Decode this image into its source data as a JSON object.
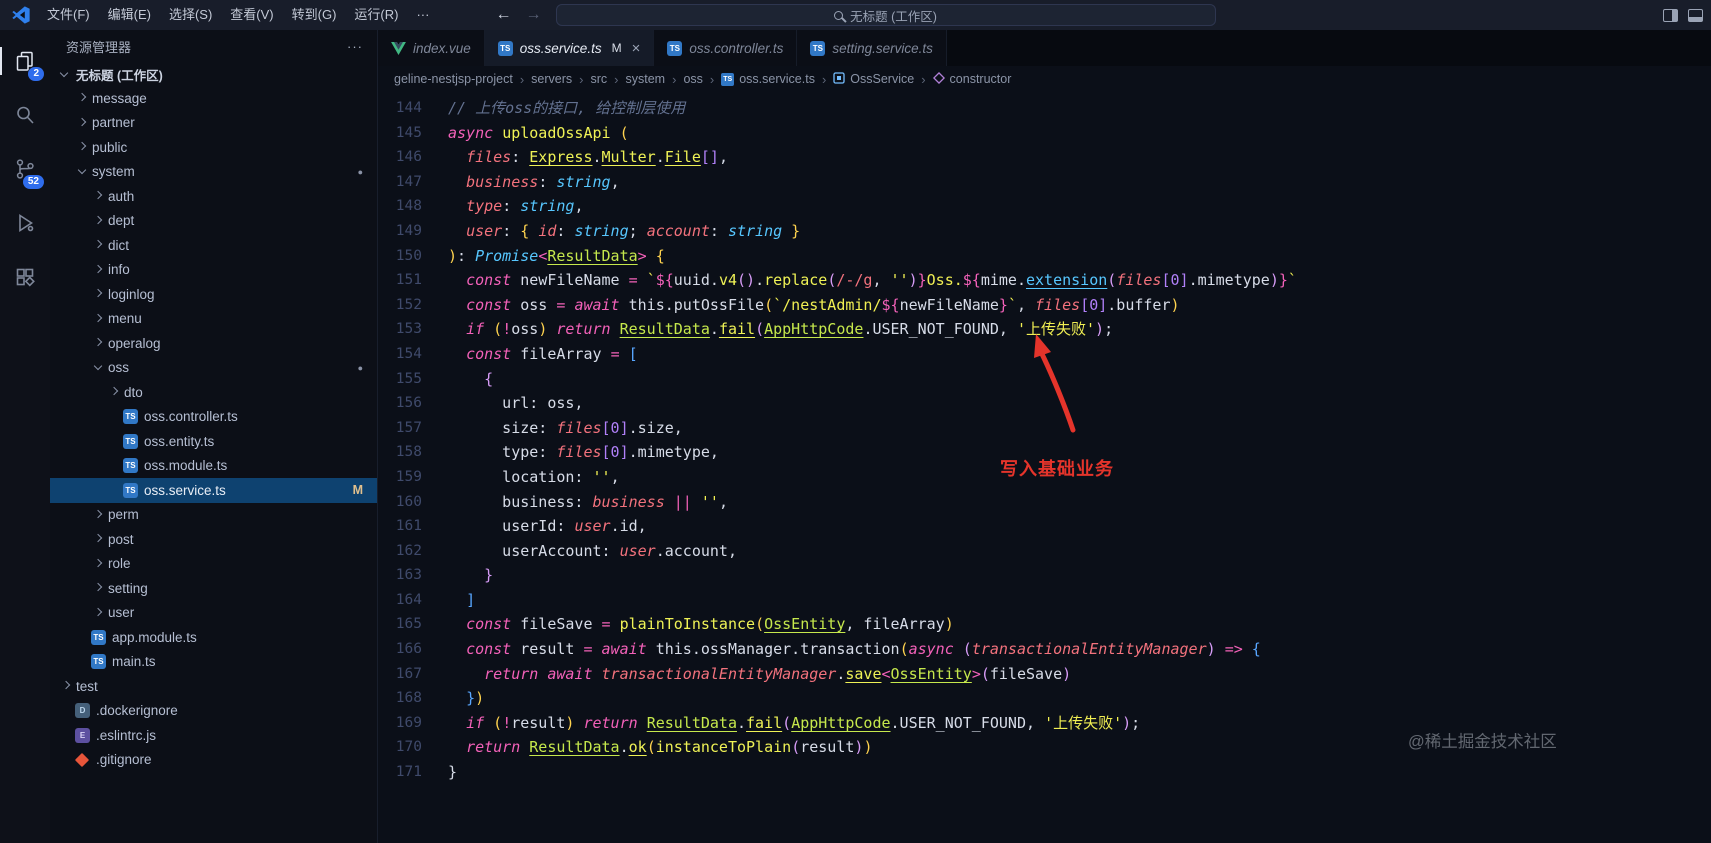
{
  "titlebar": {
    "menus": [
      "文件(F)",
      "编辑(E)",
      "选择(S)",
      "查看(V)",
      "转到(G)",
      "运行(R)"
    ],
    "more_label": "···",
    "search": "无标题 (工作区)"
  },
  "activitybar": {
    "explorer_badge": "2",
    "scm_badge": "52"
  },
  "sidebar": {
    "title": "资源管理器",
    "more_label": "···",
    "section": "无标题 (工作区)",
    "tree": [
      {
        "label": "message",
        "indent": 1,
        "chevron": "right"
      },
      {
        "label": "partner",
        "indent": 1,
        "chevron": "right"
      },
      {
        "label": "public",
        "indent": 1,
        "chevron": "right"
      },
      {
        "label": "system",
        "indent": 1,
        "chevron": "down",
        "dot": true
      },
      {
        "label": "auth",
        "indent": 2,
        "chevron": "right"
      },
      {
        "label": "dept",
        "indent": 2,
        "chevron": "right"
      },
      {
        "label": "dict",
        "indent": 2,
        "chevron": "right"
      },
      {
        "label": "info",
        "indent": 2,
        "chevron": "right"
      },
      {
        "label": "loginlog",
        "indent": 2,
        "chevron": "right"
      },
      {
        "label": "menu",
        "indent": 2,
        "chevron": "right"
      },
      {
        "label": "operalog",
        "indent": 2,
        "chevron": "right"
      },
      {
        "label": "oss",
        "indent": 2,
        "chevron": "down",
        "dot": true
      },
      {
        "label": "dto",
        "indent": 3,
        "chevron": "right"
      },
      {
        "label": "oss.controller.ts",
        "indent": 3,
        "icon": "ts"
      },
      {
        "label": "oss.entity.ts",
        "indent": 3,
        "icon": "ts"
      },
      {
        "label": "oss.module.ts",
        "indent": 3,
        "icon": "ts"
      },
      {
        "label": "oss.service.ts",
        "indent": 3,
        "icon": "ts",
        "selected": true,
        "badge": "M"
      },
      {
        "label": "perm",
        "indent": 2,
        "chevron": "right"
      },
      {
        "label": "post",
        "indent": 2,
        "chevron": "right"
      },
      {
        "label": "role",
        "indent": 2,
        "chevron": "right"
      },
      {
        "label": "setting",
        "indent": 2,
        "chevron": "right"
      },
      {
        "label": "user",
        "indent": 2,
        "chevron": "right"
      },
      {
        "label": "app.module.ts",
        "indent": 1,
        "icon": "ts"
      },
      {
        "label": "main.ts",
        "indent": 1,
        "icon": "ts"
      },
      {
        "label": "test",
        "indent": 0,
        "chevron": "right"
      },
      {
        "label": ".dockerignore",
        "indent": 0,
        "icon": "docker"
      },
      {
        "label": ".eslintrc.js",
        "indent": 0,
        "icon": "eslint"
      },
      {
        "label": ".gitignore",
        "indent": 0,
        "icon": "git"
      }
    ]
  },
  "tabs": [
    {
      "label": "index.vue",
      "icon": "vue"
    },
    {
      "label": "oss.service.ts",
      "icon": "ts",
      "active": true,
      "modified": "M",
      "closable": true
    },
    {
      "label": "oss.controller.ts",
      "icon": "ts"
    },
    {
      "label": "setting.service.ts",
      "icon": "ts"
    }
  ],
  "breadcrumb": [
    {
      "label": "geline-nestjsp-project"
    },
    {
      "label": "servers"
    },
    {
      "label": "src"
    },
    {
      "label": "system"
    },
    {
      "label": "oss"
    },
    {
      "label": "oss.service.ts",
      "icon": "ts"
    },
    {
      "label": "OssService",
      "icon": "class"
    },
    {
      "label": "constructor",
      "icon": "method"
    }
  ],
  "editor": {
    "lines": [
      {
        "n": 144,
        "t": [
          [
            "cm",
            "// 上传oss的接口, 给控制层使用"
          ]
        ]
      },
      {
        "n": 145,
        "t": [
          [
            "kw",
            "async"
          ],
          [
            "pl",
            " "
          ],
          [
            "fn",
            "uploadOssApi"
          ],
          [
            "pl",
            " "
          ],
          [
            "b1",
            "("
          ]
        ]
      },
      {
        "n": 146,
        "t": [
          [
            "pl",
            "  "
          ],
          [
            "pa",
            "files"
          ],
          [
            "pl",
            ": "
          ],
          [
            "cls",
            "Express"
          ],
          [
            "pl",
            "."
          ],
          [
            "cls",
            "Multer"
          ],
          [
            "pl",
            "."
          ],
          [
            "cls",
            "File"
          ],
          [
            "nu",
            "[]"
          ],
          [
            "pl",
            ","
          ]
        ]
      },
      {
        "n": 147,
        "t": [
          [
            "pl",
            "  "
          ],
          [
            "pa",
            "business"
          ],
          [
            "pl",
            ": "
          ],
          [
            "ty",
            "string"
          ],
          [
            "pl",
            ","
          ]
        ]
      },
      {
        "n": 148,
        "t": [
          [
            "pl",
            "  "
          ],
          [
            "pa",
            "type"
          ],
          [
            "pl",
            ": "
          ],
          [
            "ty",
            "string"
          ],
          [
            "pl",
            ","
          ]
        ]
      },
      {
        "n": 149,
        "t": [
          [
            "pl",
            "  "
          ],
          [
            "pa",
            "user"
          ],
          [
            "pl",
            ": "
          ],
          [
            "b1",
            "{ "
          ],
          [
            "pa",
            "id"
          ],
          [
            "pl",
            ": "
          ],
          [
            "ty",
            "string"
          ],
          [
            "pl",
            "; "
          ],
          [
            "pa",
            "account"
          ],
          [
            "pl",
            ": "
          ],
          [
            "ty",
            "string"
          ],
          [
            "b1",
            " }"
          ]
        ]
      },
      {
        "n": 150,
        "t": [
          [
            "b1",
            ")"
          ],
          [
            "pl",
            ": "
          ],
          [
            "ty",
            "Promise"
          ],
          [
            "op",
            "<"
          ],
          [
            "clsg",
            "ResultData"
          ],
          [
            "op",
            ">"
          ],
          [
            "pl",
            " "
          ],
          [
            "b1",
            "{"
          ]
        ]
      },
      {
        "n": 151,
        "t": [
          [
            "pl",
            "  "
          ],
          [
            "kw",
            "const"
          ],
          [
            "pl",
            " newFileName "
          ],
          [
            "op",
            "="
          ],
          [
            "pl",
            " "
          ],
          [
            "st",
            "`"
          ],
          [
            "op",
            "${"
          ],
          [
            "pl",
            "uuid."
          ],
          [
            "fn",
            "v4"
          ],
          [
            "b2",
            "()"
          ],
          [
            "pl",
            "."
          ],
          [
            "fn",
            "replace"
          ],
          [
            "b2",
            "("
          ],
          [
            "re",
            "/-/g"
          ],
          [
            "pl",
            ", "
          ],
          [
            "st",
            "''"
          ],
          [
            "b2",
            ")"
          ],
          [
            "op",
            "}"
          ],
          [
            "st",
            "Oss."
          ],
          [
            "op",
            "${"
          ],
          [
            "pl",
            "mime."
          ],
          [
            "cyu",
            "extension"
          ],
          [
            "b2",
            "("
          ],
          [
            "pa",
            "files"
          ],
          [
            "nu",
            "[0]"
          ],
          [
            "pl",
            ".mimetype"
          ],
          [
            "b2",
            ")"
          ],
          [
            "op",
            "}"
          ],
          [
            "st",
            "`"
          ]
        ]
      },
      {
        "n": 152,
        "t": [
          [
            "pl",
            "  "
          ],
          [
            "kw",
            "const"
          ],
          [
            "pl",
            " oss "
          ],
          [
            "op",
            "="
          ],
          [
            "pl",
            " "
          ],
          [
            "kw",
            "await"
          ],
          [
            "pl",
            " this.putOssFile"
          ],
          [
            "b1",
            "("
          ],
          [
            "st",
            "`/nestAdmin/"
          ],
          [
            "op",
            "${"
          ],
          [
            "pl",
            "newFileName"
          ],
          [
            "op",
            "}"
          ],
          [
            "st",
            "`"
          ],
          [
            "pl",
            ", "
          ],
          [
            "pa",
            "files"
          ],
          [
            "nu",
            "[0]"
          ],
          [
            "pl",
            ".buffer"
          ],
          [
            "b1",
            ")"
          ]
        ]
      },
      {
        "n": 153,
        "t": [
          [
            "pl",
            "  "
          ],
          [
            "kw",
            "if"
          ],
          [
            "pl",
            " "
          ],
          [
            "b1",
            "("
          ],
          [
            "op",
            "!"
          ],
          [
            "pl",
            "oss"
          ],
          [
            "b1",
            ")"
          ],
          [
            "pl",
            " "
          ],
          [
            "kw",
            "return"
          ],
          [
            "pl",
            " "
          ],
          [
            "clsg",
            "ResultData"
          ],
          [
            "pl",
            "."
          ],
          [
            "cls",
            "fail"
          ],
          [
            "b2",
            "("
          ],
          [
            "clsg",
            "AppHttpCode"
          ],
          [
            "pl",
            ".USER_NOT_FOUND, "
          ],
          [
            "st",
            "'上传失败'"
          ],
          [
            "b2",
            ")"
          ],
          [
            "pl",
            ";"
          ]
        ]
      },
      {
        "n": 154,
        "t": [
          [
            "pl",
            "  "
          ],
          [
            "kw",
            "const"
          ],
          [
            "pl",
            " fileArray "
          ],
          [
            "op",
            "="
          ],
          [
            "pl",
            " "
          ],
          [
            "b3",
            "["
          ]
        ]
      },
      {
        "n": 155,
        "t": [
          [
            "pl",
            "    "
          ],
          [
            "b2",
            "{"
          ]
        ]
      },
      {
        "n": 156,
        "t": [
          [
            "pl",
            "      url: oss,"
          ]
        ]
      },
      {
        "n": 157,
        "t": [
          [
            "pl",
            "      size: "
          ],
          [
            "pa",
            "files"
          ],
          [
            "nu",
            "[0]"
          ],
          [
            "pl",
            ".size,"
          ]
        ]
      },
      {
        "n": 158,
        "t": [
          [
            "pl",
            "      type: "
          ],
          [
            "pa",
            "files"
          ],
          [
            "nu",
            "[0]"
          ],
          [
            "pl",
            ".mimetype,"
          ]
        ]
      },
      {
        "n": 159,
        "t": [
          [
            "pl",
            "      location: "
          ],
          [
            "st",
            "''"
          ],
          [
            "pl",
            ","
          ]
        ]
      },
      {
        "n": 160,
        "t": [
          [
            "pl",
            "      business: "
          ],
          [
            "pa",
            "business"
          ],
          [
            "pl",
            " "
          ],
          [
            "op",
            "||"
          ],
          [
            "pl",
            " "
          ],
          [
            "st",
            "''"
          ],
          [
            "pl",
            ","
          ]
        ]
      },
      {
        "n": 161,
        "t": [
          [
            "pl",
            "      userId: "
          ],
          [
            "pa",
            "user"
          ],
          [
            "pl",
            ".id,"
          ]
        ]
      },
      {
        "n": 162,
        "t": [
          [
            "pl",
            "      userAccount: "
          ],
          [
            "pa",
            "user"
          ],
          [
            "pl",
            ".account,"
          ]
        ]
      },
      {
        "n": 163,
        "t": [
          [
            "pl",
            "    "
          ],
          [
            "b2",
            "}"
          ]
        ]
      },
      {
        "n": 164,
        "t": [
          [
            "pl",
            "  "
          ],
          [
            "b3",
            "]"
          ]
        ]
      },
      {
        "n": 165,
        "t": [
          [
            "pl",
            "  "
          ],
          [
            "kw",
            "const"
          ],
          [
            "pl",
            " fileSave "
          ],
          [
            "op",
            "="
          ],
          [
            "pl",
            " "
          ],
          [
            "fn",
            "plainToInstance"
          ],
          [
            "b1",
            "("
          ],
          [
            "clsg",
            "OssEntity"
          ],
          [
            "pl",
            ", fileArray"
          ],
          [
            "b1",
            ")"
          ]
        ]
      },
      {
        "n": 166,
        "t": [
          [
            "pl",
            "  "
          ],
          [
            "kw",
            "const"
          ],
          [
            "pl",
            " result "
          ],
          [
            "op",
            "="
          ],
          [
            "pl",
            " "
          ],
          [
            "kw",
            "await"
          ],
          [
            "pl",
            " this.ossManager.transaction"
          ],
          [
            "b1",
            "("
          ],
          [
            "kw",
            "async"
          ],
          [
            "pl",
            " "
          ],
          [
            "b2",
            "("
          ],
          [
            "pa",
            "transactionalEntityManager"
          ],
          [
            "b2",
            ")"
          ],
          [
            "pl",
            " "
          ],
          [
            "op",
            "=>"
          ],
          [
            "pl",
            " "
          ],
          [
            "b3",
            "{"
          ]
        ]
      },
      {
        "n": 167,
        "t": [
          [
            "pl",
            "    "
          ],
          [
            "kw",
            "return"
          ],
          [
            "pl",
            " "
          ],
          [
            "kw",
            "await"
          ],
          [
            "pl",
            " "
          ],
          [
            "pa",
            "transactionalEntityManager"
          ],
          [
            "pl",
            "."
          ],
          [
            "cls",
            "save"
          ],
          [
            "op",
            "<"
          ],
          [
            "clsg",
            "OssEntity"
          ],
          [
            "op",
            ">"
          ],
          [
            "b2",
            "("
          ],
          [
            "pl",
            "fileSave"
          ],
          [
            "b2",
            ")"
          ]
        ]
      },
      {
        "n": 168,
        "t": [
          [
            "pl",
            "  "
          ],
          [
            "b3",
            "}"
          ],
          [
            "b1",
            ")"
          ]
        ]
      },
      {
        "n": 169,
        "t": [
          [
            "pl",
            "  "
          ],
          [
            "kw",
            "if"
          ],
          [
            "pl",
            " "
          ],
          [
            "b1",
            "("
          ],
          [
            "op",
            "!"
          ],
          [
            "pl",
            "result"
          ],
          [
            "b1",
            ")"
          ],
          [
            "pl",
            " "
          ],
          [
            "kw",
            "return"
          ],
          [
            "pl",
            " "
          ],
          [
            "clsg",
            "ResultData"
          ],
          [
            "pl",
            "."
          ],
          [
            "cls",
            "fail"
          ],
          [
            "b2",
            "("
          ],
          [
            "clsg",
            "AppHttpCode"
          ],
          [
            "pl",
            ".USER_NOT_FOUND, "
          ],
          [
            "st",
            "'上传失败'"
          ],
          [
            "b2",
            ")"
          ],
          [
            "pl",
            ";"
          ]
        ]
      },
      {
        "n": 170,
        "t": [
          [
            "pl",
            "  "
          ],
          [
            "kw",
            "return"
          ],
          [
            "pl",
            " "
          ],
          [
            "clsg",
            "ResultData"
          ],
          [
            "pl",
            "."
          ],
          [
            "cls",
            "ok"
          ],
          [
            "b1",
            "("
          ],
          [
            "fn",
            "instanceToPlain"
          ],
          [
            "b2",
            "("
          ],
          [
            "pl",
            "result"
          ],
          [
            "b2",
            ")"
          ],
          [
            "b1",
            ")"
          ]
        ]
      },
      {
        "n": 171,
        "t": [
          [
            "pl",
            "}"
          ]
        ]
      }
    ]
  },
  "annotation": {
    "label": "写入基础业务"
  },
  "watermark": "@稀土掘金技术社区",
  "colors": {
    "badge_blue": "#2f6ded",
    "modified_orange": "#e2c08d",
    "annotation_red": "#e5342b",
    "ts_icon_blue": "#3178c6",
    "vue_green": "#41b883",
    "selection_blue": "#0e4270"
  }
}
